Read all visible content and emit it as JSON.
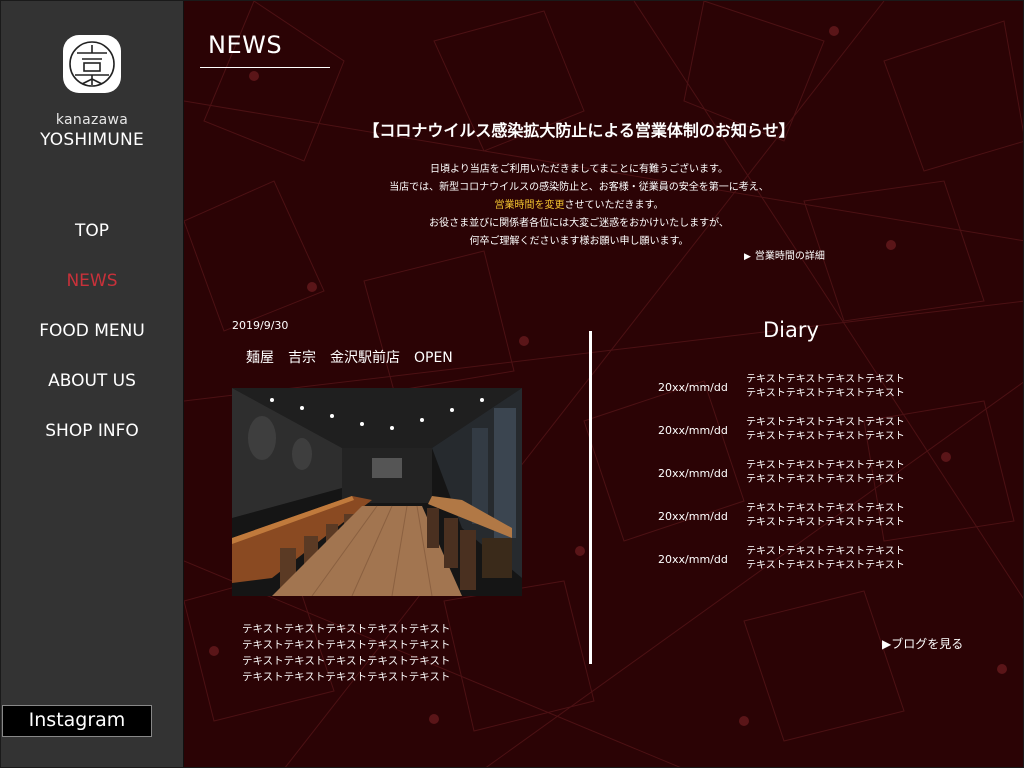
{
  "brand": {
    "small": "kanazawa",
    "large": "YOSHIMUNE",
    "logo_icon": "yoshimune-logo-icon"
  },
  "nav": {
    "items": [
      {
        "label": "TOP",
        "active": false
      },
      {
        "label": "NEWS",
        "active": true
      },
      {
        "label": "FOOD MENU",
        "active": false
      },
      {
        "label": "ABOUT US",
        "active": false
      },
      {
        "label": "SHOP INFO",
        "active": false
      }
    ],
    "active_color": "#c8313a"
  },
  "instagram_label": "Instagram",
  "page_title": "NEWS",
  "notice": {
    "title": "【コロナウイルス感染拡大防止による営業体制のお知らせ】",
    "line1": "日頃より当店をご利用いただきましてまことに有難うございます。",
    "line2": "当店では、新型コロナウイルスの感染防止と、お客様・従業員の安全を第一に考え、",
    "line3_highlight": "営業時間を変更",
    "line3_rest": "させていただきます。",
    "line4": "お役さま並びに関係者各位には大変ご迷惑をおかけいたしますが、",
    "line5": "何卒ご理解くださいます様お願い申し願います。",
    "detail_link": "営業時間の詳細",
    "highlight_color": "#f2c230"
  },
  "post": {
    "date": "2019/9/30",
    "title": "麺屋　吉宗　金沢駅前店　OPEN",
    "image": "restaurant-interior-photo",
    "text_lines": [
      "テキストテキストテキストテキストテキスト",
      "テキストテキストテキストテキストテキスト",
      "テキストテキストテキストテキストテキスト",
      "テキストテキストテキストテキストテキスト"
    ]
  },
  "diary": {
    "heading": "Diary",
    "entries": [
      {
        "date": "20xx/mm/dd",
        "line1": "テキストテキストテキストテキスト",
        "line2": "テキストテキストテキストテキスト"
      },
      {
        "date": "20xx/mm/dd",
        "line1": "テキストテキストテキストテキスト",
        "line2": "テキストテキストテキストテキスト"
      },
      {
        "date": "20xx/mm/dd",
        "line1": "テキストテキストテキストテキスト",
        "line2": "テキストテキストテキストテキスト"
      },
      {
        "date": "20xx/mm/dd",
        "line1": "テキストテキストテキストテキスト",
        "line2": "テキストテキストテキストテキスト"
      },
      {
        "date": "20xx/mm/dd",
        "line1": "テキストテキストテキストテキスト",
        "line2": "テキストテキストテキストテキスト"
      }
    ],
    "blog_link": "▶ブログを見る"
  },
  "colors": {
    "sidebar_bg": "#333333",
    "main_bg": "#2b0305",
    "pattern_line": "#5a1518"
  }
}
